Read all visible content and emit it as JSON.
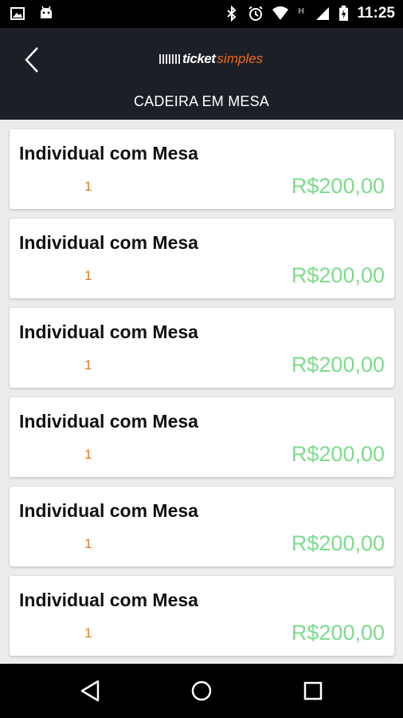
{
  "status_bar": {
    "time": "11:25",
    "left_icons": [
      "image-icon",
      "android-icon"
    ],
    "right_icons": [
      "bluetooth-icon",
      "alarm-icon",
      "wifi-icon",
      "signal-h-icon",
      "cell-signal-icon",
      "battery-charging-icon"
    ]
  },
  "header": {
    "logo": {
      "part1": "ticket",
      "part2": "simples"
    },
    "title": "CADEIRA EM MESA",
    "background": "#1d1f27"
  },
  "tickets": [
    {
      "name": "Individual com Mesa",
      "quantity": "1",
      "price": "R$200,00"
    },
    {
      "name": "Individual com Mesa",
      "quantity": "1",
      "price": "R$200,00"
    },
    {
      "name": "Individual com Mesa",
      "quantity": "1",
      "price": "R$200,00"
    },
    {
      "name": "Individual com Mesa",
      "quantity": "1",
      "price": "R$200,00"
    },
    {
      "name": "Individual com Mesa",
      "quantity": "1",
      "price": "R$200,00"
    },
    {
      "name": "Individual com Mesa",
      "quantity": "1",
      "price": "R$200,00"
    }
  ],
  "colors": {
    "price": "#7ddc8c",
    "quantity": "#e07a1f",
    "brand_accent": "#f26a1b"
  },
  "nav_bar": {
    "buttons": [
      "back-icon",
      "home-icon",
      "recents-icon"
    ]
  }
}
